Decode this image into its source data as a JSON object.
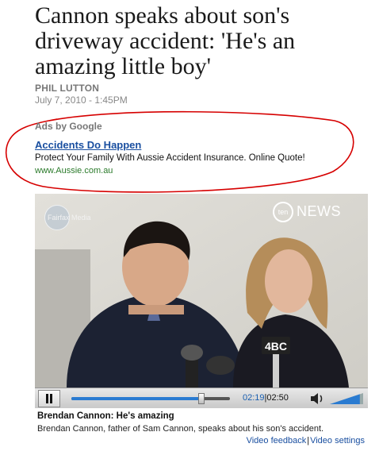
{
  "article": {
    "headline": "Cannon speaks about son's driveway accident: 'He's an amazing little boy'",
    "author": "PHIL LUTTON",
    "date": "July 7, 2010 - 1:45PM"
  },
  "ads": {
    "label": "Ads by Google",
    "title": "Accidents Do Happen",
    "text": "Protect Your Family With Aussie Accident Insurance. Online Quote!",
    "url": "www.Aussie.com.au",
    "highlight_color": "#d60000"
  },
  "video": {
    "watermark_left": "Fairfax Media",
    "watermark_right_small": "ten",
    "watermark_right": "NEWS",
    "mic_label": "4BC",
    "current_time": "02:19",
    "duration": "02:50",
    "progress": 0.82,
    "volume": 0.9,
    "pause_icon": "pause-icon",
    "volume_icon": "speaker-icon"
  },
  "caption": {
    "title": "Brendan Cannon: He's amazing",
    "text": "Brendan Cannon, father of Sam Cannon, speaks about his son's accident.",
    "link_feedback": "Video feedback",
    "separator": "|",
    "link_settings": "Video settings"
  }
}
